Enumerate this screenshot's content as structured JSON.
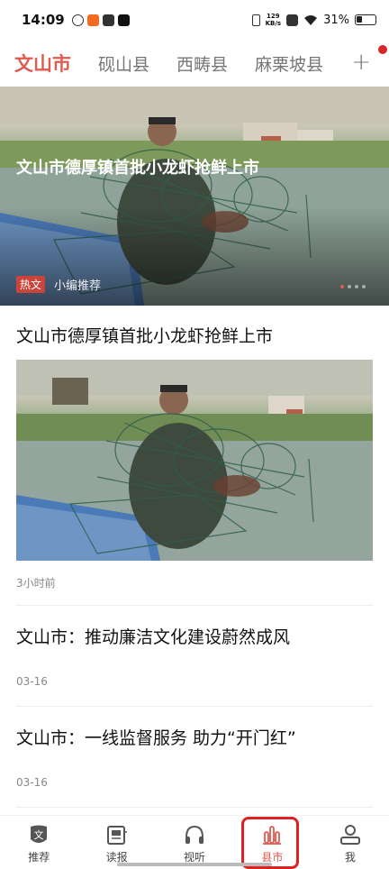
{
  "status_bar": {
    "time": "14:09",
    "net_speed_value": "129",
    "net_speed_unit": "KB/s",
    "battery": "31%"
  },
  "channels": {
    "tabs": [
      "文山市",
      "砚山县",
      "西畴县",
      "麻栗坡县"
    ],
    "active": "文山市",
    "add_symbol": "+"
  },
  "hero": {
    "title": "文山市德厚镇首批小龙虾抢鲜上市",
    "badge": "热文",
    "editor": "小编推荐",
    "carousel_position": "1 of 4"
  },
  "articles": [
    {
      "title": "文山市德厚镇首批小龙虾抢鲜上市",
      "time": "3小时前",
      "has_image": true
    },
    {
      "title": "文山市：推动廉洁文化建设蔚然成风",
      "time": "03-16"
    },
    {
      "title": "文山市：一线监督服务 助力“开门红”",
      "time": "03-16"
    }
  ],
  "bottom_nav": {
    "items": [
      {
        "label": "推荐",
        "icon": "recommend-icon"
      },
      {
        "label": "读报",
        "icon": "newspaper-icon"
      },
      {
        "label": "视听",
        "icon": "headphones-icon"
      },
      {
        "label": "县市",
        "icon": "county-icon"
      },
      {
        "label": "我",
        "icon": "user-icon"
      }
    ],
    "active": "县市"
  },
  "colors": {
    "accent": "#e05a4f",
    "highlight_box": "#e02020",
    "hot_badge": "#c9453b"
  }
}
